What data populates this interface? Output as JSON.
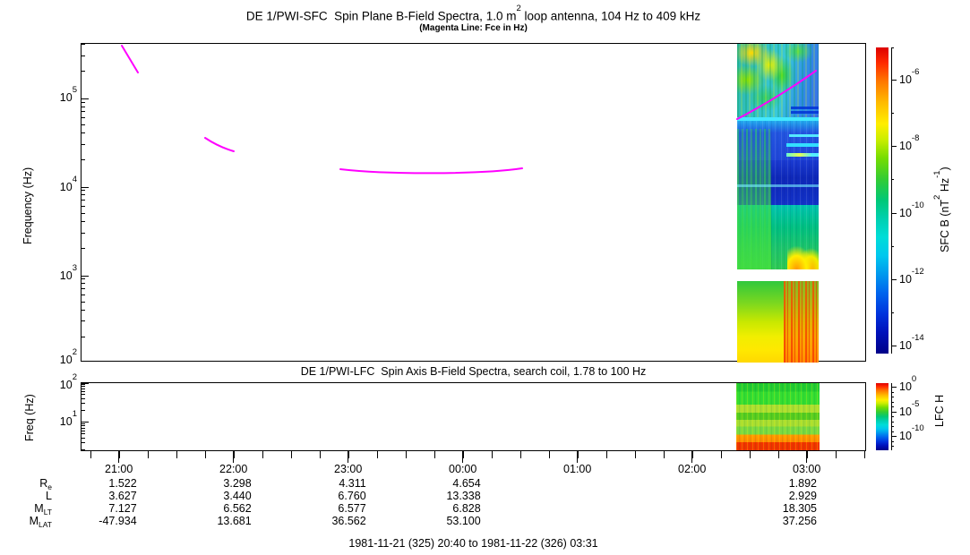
{
  "header": {
    "title_pre": "DE 1/PWI-SFC  Spin Plane B-Field Spectra, 1.0 m",
    "title_sup": "2",
    "title_post": " loop antenna, 104 Hz to 409 kHz",
    "subtitle": "(Magenta Line: Fce in Hz)"
  },
  "sfc_panel": {
    "ylabel": "Frequency (Hz)",
    "yticks": [
      {
        "base": "10",
        "exp": "5"
      },
      {
        "base": "10",
        "exp": "4"
      },
      {
        "base": "10",
        "exp": "3"
      },
      {
        "base": "10",
        "exp": "2"
      }
    ],
    "colorbar": {
      "ticks": [
        {
          "base": "10",
          "exp": "-6"
        },
        {
          "base": "10",
          "exp": "-8"
        },
        {
          "base": "10",
          "exp": "-10"
        },
        {
          "base": "10",
          "exp": "-12"
        },
        {
          "base": "10",
          "exp": "-14"
        }
      ],
      "label_pre": "SFC B (nT",
      "label_sup1": "2",
      "label_mid": " Hz",
      "label_sup2": "-1",
      "label_post": ")"
    }
  },
  "lfc_panel": {
    "title": "DE 1/PWI-LFC  Spin Axis B-Field Spectra, search coil, 1.78 to 100 Hz",
    "ylabel": "Freq (Hz)",
    "yticks": [
      {
        "base": "10",
        "exp": "2"
      },
      {
        "base": "10",
        "exp": "1"
      }
    ],
    "colorbar": {
      "ticks": [
        {
          "base": "10",
          "exp": "0"
        },
        {
          "base": "10",
          "exp": "-5"
        },
        {
          "base": "10",
          "exp": "-10"
        }
      ],
      "label": "LFC H"
    }
  },
  "xaxis": {
    "labels": [
      "21:00",
      "22:00",
      "23:00",
      "00:00",
      "01:00",
      "02:00",
      "03:00"
    ]
  },
  "table": {
    "rows": [
      {
        "label": "R",
        "sub": "e",
        "values": [
          "1.522",
          "3.298",
          "4.311",
          "4.654",
          "",
          "",
          "1.892"
        ]
      },
      {
        "label": "L",
        "sub": "",
        "values": [
          "3.627",
          "3.440",
          "6.760",
          "13.338",
          "",
          "",
          "2.929"
        ]
      },
      {
        "label": "M",
        "sub": "LT",
        "values": [
          "7.127",
          "6.562",
          "6.577",
          "6.828",
          "",
          "",
          "18.305"
        ]
      },
      {
        "label": "M",
        "sub": "LAT",
        "values": [
          "-47.934",
          "13.681",
          "36.562",
          "53.100",
          "",
          "",
          "37.256"
        ]
      }
    ]
  },
  "footer": "1981-11-21 (325) 20:40 to 1981-11-22 (326) 03:31",
  "colors": {
    "fce_line": "#ff00ff",
    "axis": "#000000",
    "colorbar_scale": [
      "#dd0000",
      "#ff7700",
      "#ffee00",
      "#33cc33",
      "#00ddd8",
      "#0066ee",
      "#000088"
    ]
  },
  "chart_data": [
    {
      "type": "heatmap",
      "title": "DE 1/PWI-SFC  Spin Plane B-Field Spectra, 1.0 m2 loop antenna, 104 Hz to 409 kHz",
      "subtitle": "(Magenta Line: Fce in Hz)",
      "ylabel": "Frequency (Hz)",
      "yscale": "log",
      "ylim_hz": [
        104,
        409000
      ],
      "ytick_labels": [
        "10^2",
        "10^3",
        "10^4",
        "10^5"
      ],
      "x_start": "1981-11-21 20:40",
      "x_end": "1981-11-22 03:31",
      "xtick_labels": [
        "21:00",
        "22:00",
        "23:00",
        "00:00",
        "01:00",
        "02:00",
        "03:00"
      ],
      "xtick_minor_interval_min": 15,
      "grid": false,
      "colorbar": {
        "label": "SFC B (nT^2 Hz^-1)",
        "scale": "log",
        "tick_labels": [
          "10^-6",
          "10^-8",
          "10^-10",
          "10^-12",
          "10^-14"
        ],
        "range_approx": [
          "1e-14.5",
          "1e-5"
        ]
      },
      "data_coverage": "Spectrogram pixels present only from about 02:23 to 03:06 UT; panel is blank (white) elsewhere.",
      "features": [
        "02:23-03:06, 100-409 kHz: turbulent yellow/green auroral emission patch over cyan-blue background",
        "02:23-03:06, ~20-60 kHz: dark blue band crossed by thin cyan horizontal lines (narrowband emissions)",
        "02:23-03:06, ~1.5-15 kHz: teal-green band with yellow/orange burst near 02:55-03:05 at ~1-3 kHz",
        "02:23-03:06, ~104-900 Hz: intense band grading green (top) to yellow (bottom) with red vertical striations after ~02:50",
        "white horizontal data gap near 900 Hz - 1 kHz"
      ],
      "fce_line_segments": [
        {
          "t_start": "21:01",
          "t_end": "21:10",
          "f_start_hz": 395000,
          "f_end_hz": 200000
        },
        {
          "t_start": "21:45",
          "t_end": "22:00",
          "f_start_hz": 36000,
          "f_end_hz": 25000
        },
        {
          "t_start": "22:55",
          "t_end": "00:31",
          "f_start_hz": 16000,
          "f_min_hz": 14000,
          "f_end_hz": 15500
        },
        {
          "t_start": "02:23",
          "t_end": "03:04",
          "f_start_hz": 60000,
          "f_end_hz": 205000
        }
      ]
    },
    {
      "type": "heatmap",
      "title": "DE 1/PWI-LFC  Spin Axis B-Field Spectra, search coil, 1.78 to 100 Hz",
      "ylabel": "Freq (Hz)",
      "yscale": "log",
      "ylim_hz": [
        1.78,
        100
      ],
      "ytick_labels": [
        "10^1",
        "10^2"
      ],
      "x_start": "1981-11-21 20:40",
      "x_end": "1981-11-22 03:31",
      "colorbar": {
        "label": "LFC H",
        "scale": "log",
        "tick_labels": [
          "10^0",
          "10^-5",
          "10^-10"
        ]
      },
      "data_coverage": "Data present only from about 02:23 to 03:07 UT.",
      "features": [
        "horizontally banded spectrum: green at 20-100 Hz, yellow-green bands 8-20 Hz, orange band ~4-6 Hz, red band at lowest frequencies ~2-3 Hz"
      ]
    },
    {
      "type": "table",
      "name": "orbit ephemeris annotations",
      "time_columns": [
        "21:00",
        "22:00",
        "23:00",
        "00:00",
        "03:00"
      ],
      "rows": [
        {
          "label": "Re",
          "values": [
            1.522,
            3.298,
            4.311,
            4.654,
            1.892
          ]
        },
        {
          "label": "L",
          "values": [
            3.627,
            3.44,
            6.76,
            13.338,
            2.929
          ]
        },
        {
          "label": "MLT",
          "values": [
            7.127,
            6.562,
            6.577,
            6.828,
            18.305
          ]
        },
        {
          "label": "MLAT",
          "values": [
            -47.934,
            13.681,
            36.562,
            53.1,
            37.256
          ]
        }
      ],
      "footer": "1981-11-21 (325) 20:40 to 1981-11-22 (326) 03:31"
    }
  ]
}
